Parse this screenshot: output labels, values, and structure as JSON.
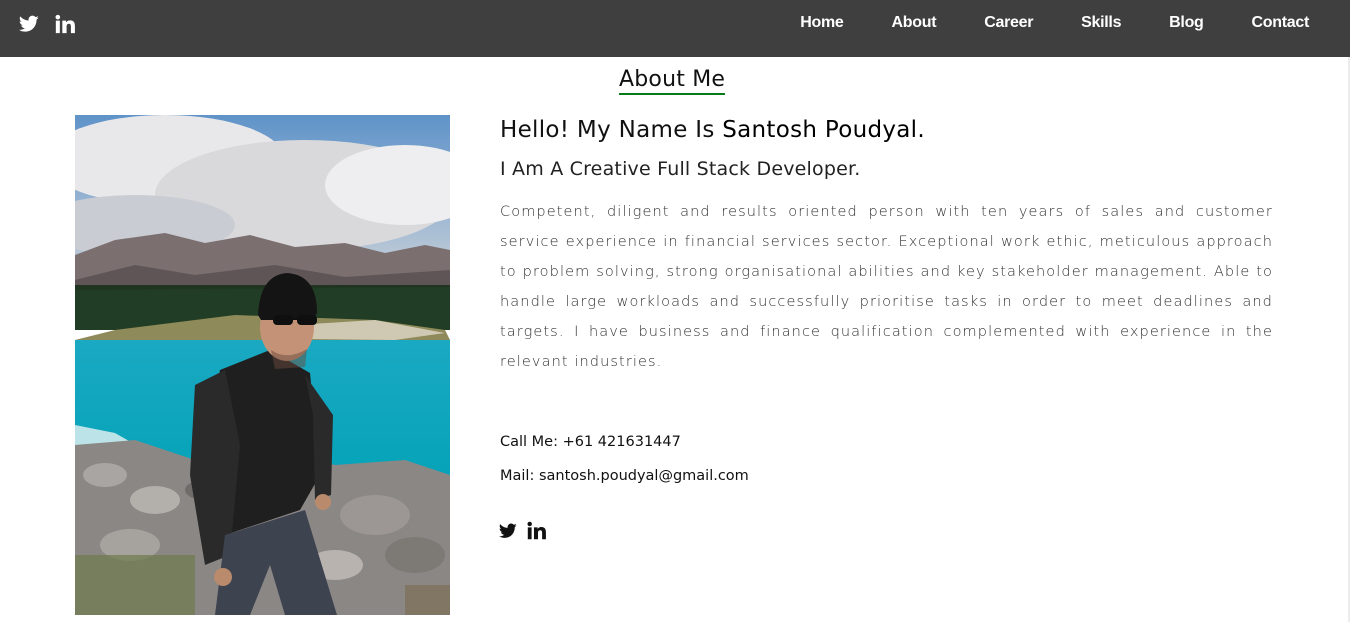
{
  "nav": {
    "social": [
      {
        "name": "twitter-icon"
      },
      {
        "name": "linkedin-icon"
      }
    ],
    "links": [
      "Home",
      "About",
      "Career",
      "Skills",
      "Blog",
      "Contact"
    ]
  },
  "section": {
    "title": "About Me"
  },
  "profile": {
    "greeting_prefix": "Hello! My Name Is ",
    "name": "Santosh Poudyal.",
    "subtitle": "I Am A Creative Full Stack Developer.",
    "bio": "Competent, diligent and results oriented person with ten years of sales and customer service experience in financial services sector. Exceptional work ethic, meticulous approach to problem solving, strong organisational abilities and key stakeholder management. Able to handle large workloads and successfully prioritise tasks in order to meet deadlines and targets. I have business and finance qualification complemented with experience in the relevant industries.",
    "phone_line": "Call Me: +61 421631447",
    "mail_line": "Mail: santosh.poudyal@gmail.com"
  },
  "colors": {
    "navbar": "#3f3f3f",
    "accent_underline": "#0a7a1f"
  }
}
